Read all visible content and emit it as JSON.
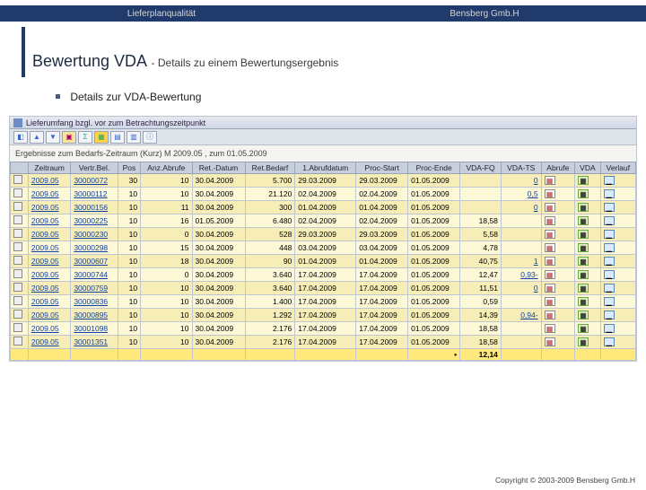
{
  "header": {
    "left": "Lieferplanqualität",
    "right": "Bensberg Gmb.H"
  },
  "title": {
    "main": "Bewertung VDA",
    "sub": " - Details zu einem Bewertungsergebnis"
  },
  "bullet": "Details zur VDA-Bewertung",
  "app": {
    "title": "Lieferumfang bzgl. vor zum Betrachtungszeitpunkt",
    "subline": "Ergebnisse zum Bedarfs-Zeitraum (Kurz) M 2009.05 , zum 01.05.2009"
  },
  "columns": [
    "",
    "Zeitraum",
    "Vertr.Bel.",
    "Pos",
    "Anz.Abrufe",
    "Ret.-Datum",
    "Ret.Bedarf",
    "1.Abrufdatum",
    "Proc-Start",
    "Proc-Ende",
    "VDA-FQ",
    "VDA-TS",
    "Abrufe",
    "VDA",
    "Verlauf"
  ],
  "rows": [
    {
      "z": "2009.05",
      "v": "30000072",
      "p": "30",
      "a": "10",
      "rd": "30.04.2009",
      "rb": "5.700",
      "ad": "29.03.2009",
      "ps": "29.03.2009",
      "pe": "01.05.2009",
      "fq": "",
      "ts": "0",
      "sel": true
    },
    {
      "z": "2009.05",
      "v": "30000112",
      "p": "10",
      "a": "10",
      "rd": "30.04.2009",
      "rb": "21.120",
      "ad": "02.04.2009",
      "ps": "02.04.2009",
      "pe": "01.05.2009",
      "fq": "",
      "ts": "0,5",
      "sel": true
    },
    {
      "z": "2009.05",
      "v": "30000156",
      "p": "10",
      "a": "11",
      "rd": "30.04.2009",
      "rb": "300",
      "ad": "01.04.2009",
      "ps": "01.04.2009",
      "pe": "01.05.2009",
      "fq": "",
      "ts": "0",
      "sel": true
    },
    {
      "z": "2009.05",
      "v": "30000225",
      "p": "10",
      "a": "16",
      "rd": "01.05.2009",
      "rb": "6.480",
      "ad": "02.04.2009",
      "ps": "02.04.2009",
      "pe": "01.05.2009",
      "fq": "18,58",
      "ts": "",
      "sel": true
    },
    {
      "z": "2009.05",
      "v": "30000230",
      "p": "10",
      "a": "0",
      "rd": "30.04.2009",
      "rb": "528",
      "ad": "29.03.2009",
      "ps": "29.03.2009",
      "pe": "01.05.2009",
      "fq": "5,58",
      "ts": "",
      "sel": true
    },
    {
      "z": "2009.05",
      "v": "30000298",
      "p": "10",
      "a": "15",
      "rd": "30.04.2009",
      "rb": "448",
      "ad": "03.04.2009",
      "ps": "03.04.2009",
      "pe": "01.05.2009",
      "fq": "4,78",
      "ts": "",
      "sel": true
    },
    {
      "z": "2009.05",
      "v": "30000607",
      "p": "10",
      "a": "18",
      "rd": "30.04.2009",
      "rb": "90",
      "ad": "01.04.2009",
      "ps": "01.04.2009",
      "pe": "01.05.2009",
      "fq": "40,75",
      "ts": "1",
      "sel": true
    },
    {
      "z": "2009.05",
      "v": "30000744",
      "p": "10",
      "a": "0",
      "rd": "30.04.2009",
      "rb": "3.640",
      "ad": "17.04.2009",
      "ps": "17.04.2009",
      "pe": "01.05.2009",
      "fq": "12,47",
      "ts": "0,93-",
      "sel": true
    },
    {
      "z": "2009.05",
      "v": "30000759",
      "p": "10",
      "a": "10",
      "rd": "30.04.2009",
      "rb": "3.640",
      "ad": "17.04.2009",
      "ps": "17.04.2009",
      "pe": "01.05.2009",
      "fq": "11,51",
      "ts": "0",
      "sel": true
    },
    {
      "z": "2009.05",
      "v": "30000836",
      "p": "10",
      "a": "10",
      "rd": "30.04.2009",
      "rb": "1.400",
      "ad": "17.04.2009",
      "ps": "17.04.2009",
      "pe": "01.05.2009",
      "fq": "0,59",
      "ts": "",
      "sel": true
    },
    {
      "z": "2009.05",
      "v": "30000895",
      "p": "10",
      "a": "10",
      "rd": "30.04.2009",
      "rb": "1.292",
      "ad": "17.04.2009",
      "ps": "17.04.2009",
      "pe": "01.05.2009",
      "fq": "14,39",
      "ts": "0,94-",
      "sel": true
    },
    {
      "z": "2009.05",
      "v": "30001098",
      "p": "10",
      "a": "10",
      "rd": "30.04.2009",
      "rb": "2.176",
      "ad": "17.04.2009",
      "ps": "17.04.2009",
      "pe": "01.05.2009",
      "fq": "18,58",
      "ts": "",
      "sel": true
    },
    {
      "z": "2009.05",
      "v": "30001351",
      "p": "10",
      "a": "10",
      "rd": "30.04.2009",
      "rb": "2.176",
      "ad": "17.04.2009",
      "ps": "17.04.2009",
      "pe": "01.05.2009",
      "fq": "18,58",
      "ts": "",
      "sel": true
    }
  ],
  "total_fq": "12,14",
  "footer": "Copyright © 2003-2009 Bensberg Gmb.H"
}
